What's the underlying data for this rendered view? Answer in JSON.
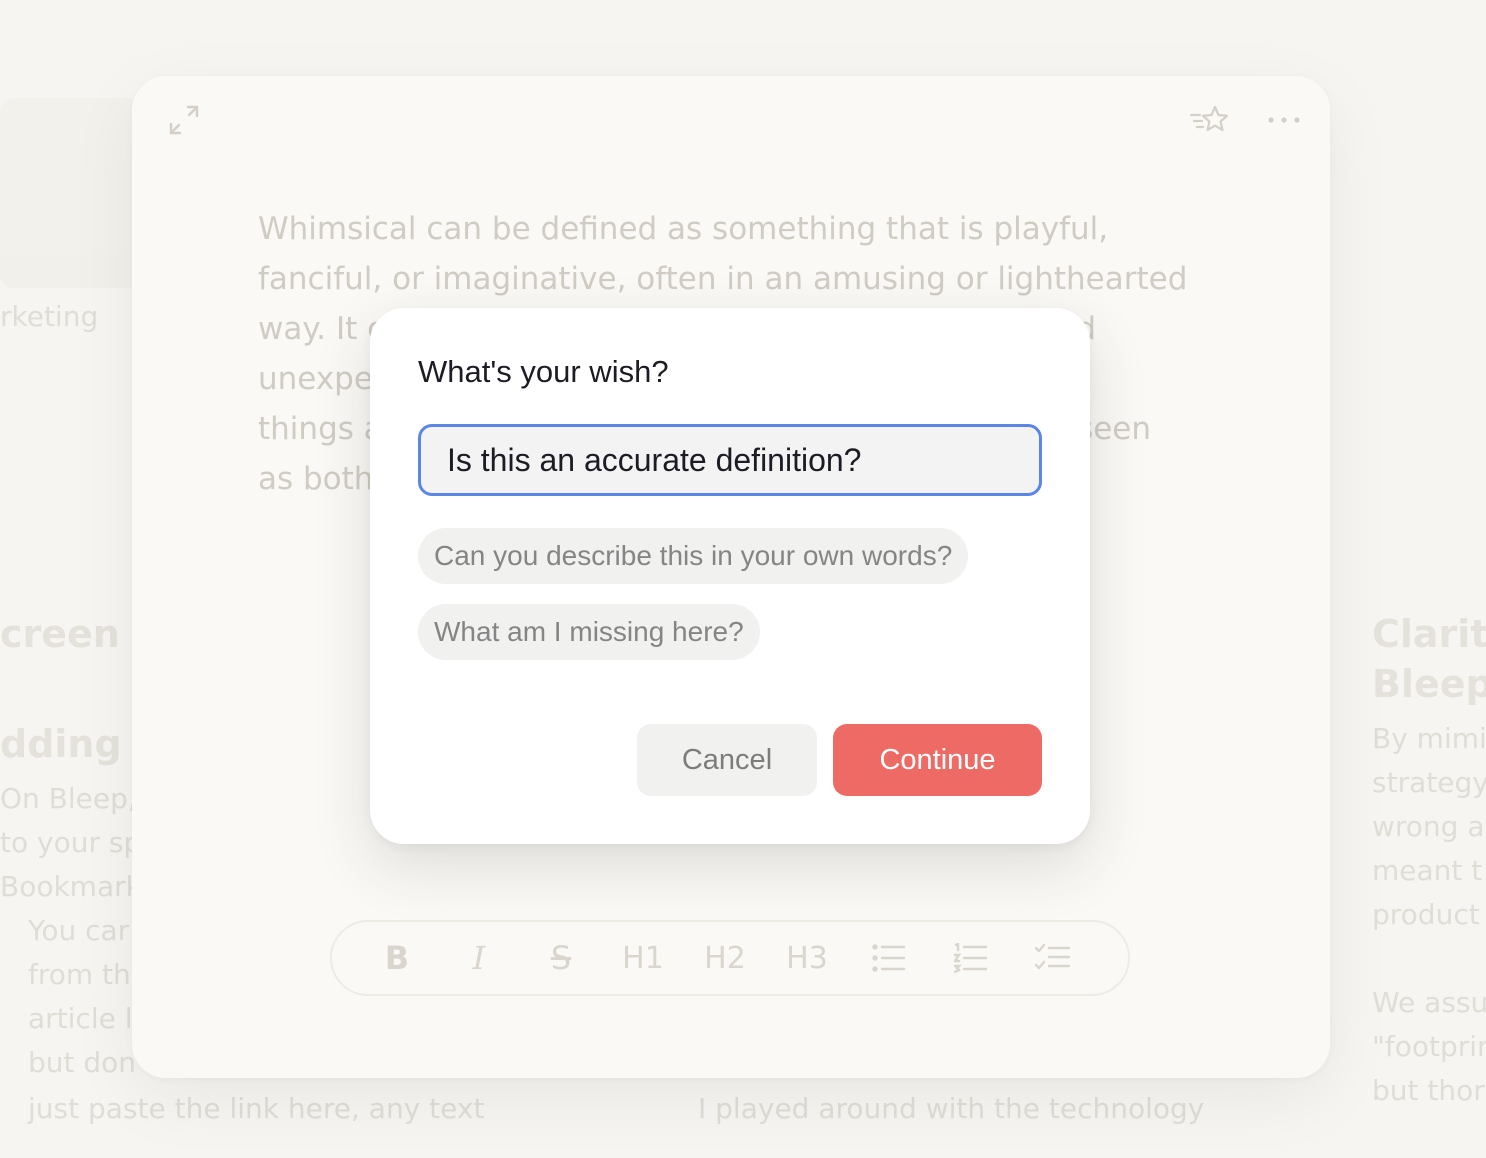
{
  "background": {
    "snippets": [
      "rketing",
      "creen",
      "dding t",
      "On Bleep,",
      "to your sp",
      "Bookmark",
      "You car",
      "from th",
      "article l",
      "but don",
      "Clarity",
      "Bleep",
      "By mimi",
      "strategy",
      "wrong a",
      "meant t",
      "product",
      "We assu",
      "\"footprin",
      "but thor",
      "just paste the link here, any text",
      "I played around with the technology"
    ]
  },
  "note": {
    "text": "Whimsical can be defined as something that is playful, fanciful, or imaginative, often in an amusing or lighthearted way. It can describe actions that are spontaneous and unexpected, following fanciful inclinations. Whimsical things are often unpredictable or quirky, and can be seen as both charming.",
    "toolbar": {
      "bold": "B",
      "italic": "I",
      "strike": "S",
      "h1": "H1",
      "h2": "H2",
      "h3": "H3"
    }
  },
  "dialog": {
    "title": "What's your wish?",
    "input_value": "Is this an accurate definition?",
    "suggestions": [
      "Can you describe this in your own words?",
      "What am I missing here?"
    ],
    "cancel_label": "Cancel",
    "continue_label": "Continue"
  },
  "colors": {
    "accent": "#ee6b65",
    "focus": "#5b86e5"
  },
  "icons": [
    "expand-icon",
    "star-icon",
    "more-icon",
    "bullet-list-icon",
    "numbered-list-icon",
    "checklist-icon"
  ]
}
